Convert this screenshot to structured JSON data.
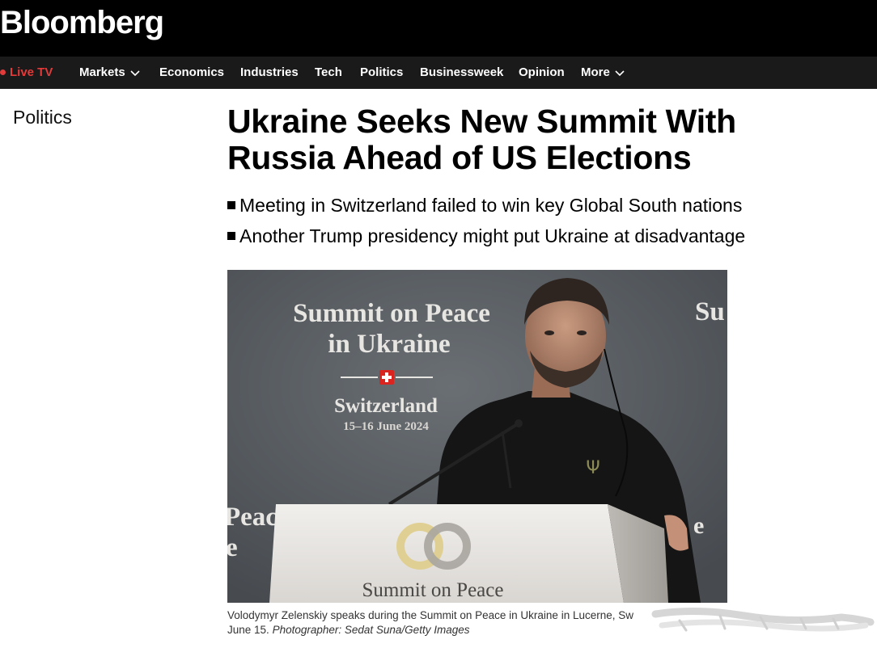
{
  "brand": {
    "logo": "Bloomberg"
  },
  "nav": {
    "live_tv": "Live TV",
    "items": [
      "Markets",
      "Economics",
      "Industries",
      "Tech",
      "Politics",
      "Businessweek",
      "Opinion",
      "More"
    ]
  },
  "article": {
    "section": "Politics",
    "headline_line1": "Ukraine Seeks New Summit With",
    "headline_line2": "Russia Ahead of US Elections",
    "bullets": [
      "Meeting in Switzerland failed to win key Global South nations",
      "Another Trump presidency might put Ukraine at disadvantage"
    ],
    "photo": {
      "backdrop_title_line1": "Summit on Peace",
      "backdrop_title_line2": "in Ukraine",
      "backdrop_country": "Switzerland",
      "backdrop_dates": "15–16 June 2024",
      "podium_text": "Summit on Peace",
      "right_edge_text": "Su",
      "left_edge_text1": "Peace",
      "left_edge_text2": "e"
    },
    "caption_line1": "Volodymyr Zelenskiy speaks during the Summit on Peace in Ukraine in Lucerne, Sw",
    "caption_date": "June 15.",
    "caption_credit": "Photographer: Sedat Suna/Getty Images"
  },
  "colors": {
    "accent_live": "#e33a3a",
    "nav_bg": "#1a1a1a",
    "brand_bg": "#000000"
  }
}
